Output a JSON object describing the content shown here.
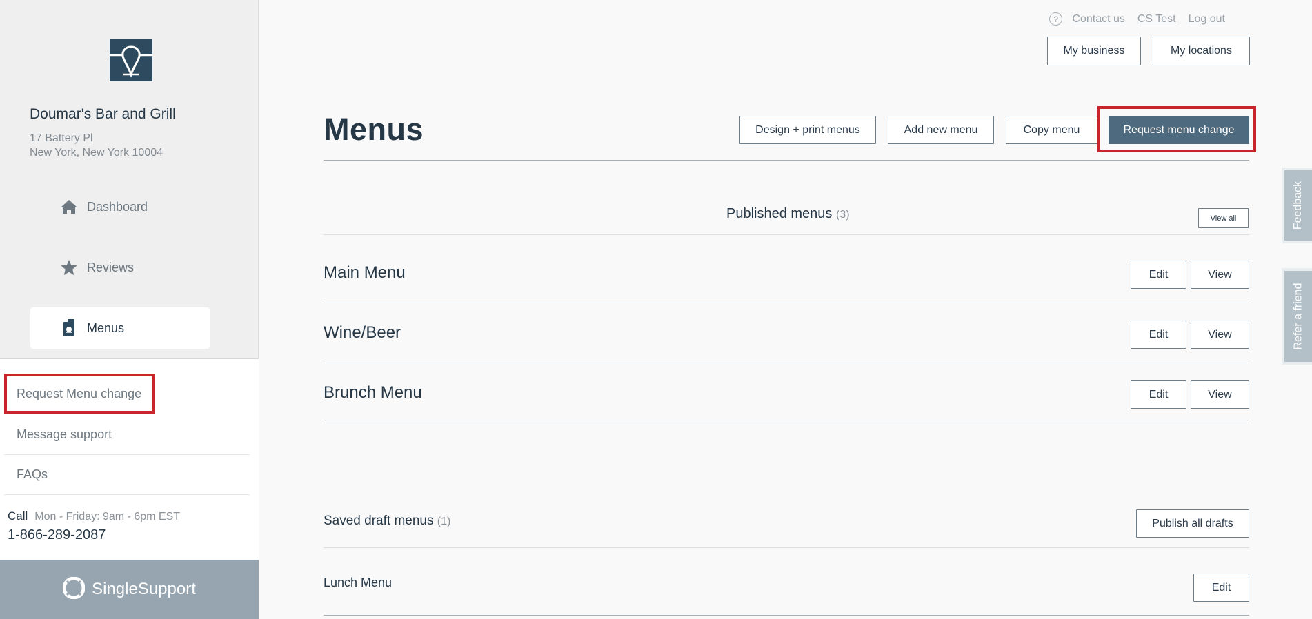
{
  "sidebar": {
    "business_name": "Doumar's Bar and Grill",
    "address_line1": "17 Battery Pl",
    "address_line2": "New York, New York 10004",
    "nav": [
      {
        "label": "Dashboard",
        "icon": "home-icon",
        "active": false
      },
      {
        "label": "Reviews",
        "icon": "star-icon",
        "active": false
      },
      {
        "label": "Menus",
        "icon": "menu-book-icon",
        "active": true
      }
    ],
    "support_links": [
      "Request Menu change",
      "Message support",
      "FAQs"
    ],
    "call_label": "Call",
    "call_hours": "Mon - Friday: 9am - 6pm EST",
    "phone": "1-866-289-2087",
    "brand": "SingleSupport"
  },
  "header": {
    "help_icon": "?",
    "links": [
      "Contact us",
      "CS Test",
      "Log out"
    ],
    "my_business": "My business",
    "my_locations": "My locations"
  },
  "main": {
    "title": "Menus",
    "actions": {
      "design_print": "Design + print menus",
      "add_new": "Add new menu",
      "copy": "Copy menu",
      "request_change": "Request menu change"
    },
    "published": {
      "title": "Published menus",
      "count": "(3)",
      "view_all": "View all",
      "items": [
        {
          "name": "Main Menu",
          "edit": "Edit",
          "view": "View"
        },
        {
          "name": "Wine/Beer",
          "edit": "Edit",
          "view": "View"
        },
        {
          "name": "Brunch Menu",
          "edit": "Edit",
          "view": "View"
        }
      ]
    },
    "drafts": {
      "title": "Saved draft menus",
      "count": "(1)",
      "publish_all": "Publish all drafts",
      "items": [
        {
          "name": "Lunch Menu",
          "edit": "Edit"
        }
      ]
    }
  },
  "side_tabs": {
    "feedback": "Feedback",
    "refer": "Refer a friend"
  },
  "colors": {
    "primary": "#4e6a7f",
    "highlight": "#c8262c",
    "brand_bar": "#96a5b0",
    "text_dark": "#263746"
  }
}
